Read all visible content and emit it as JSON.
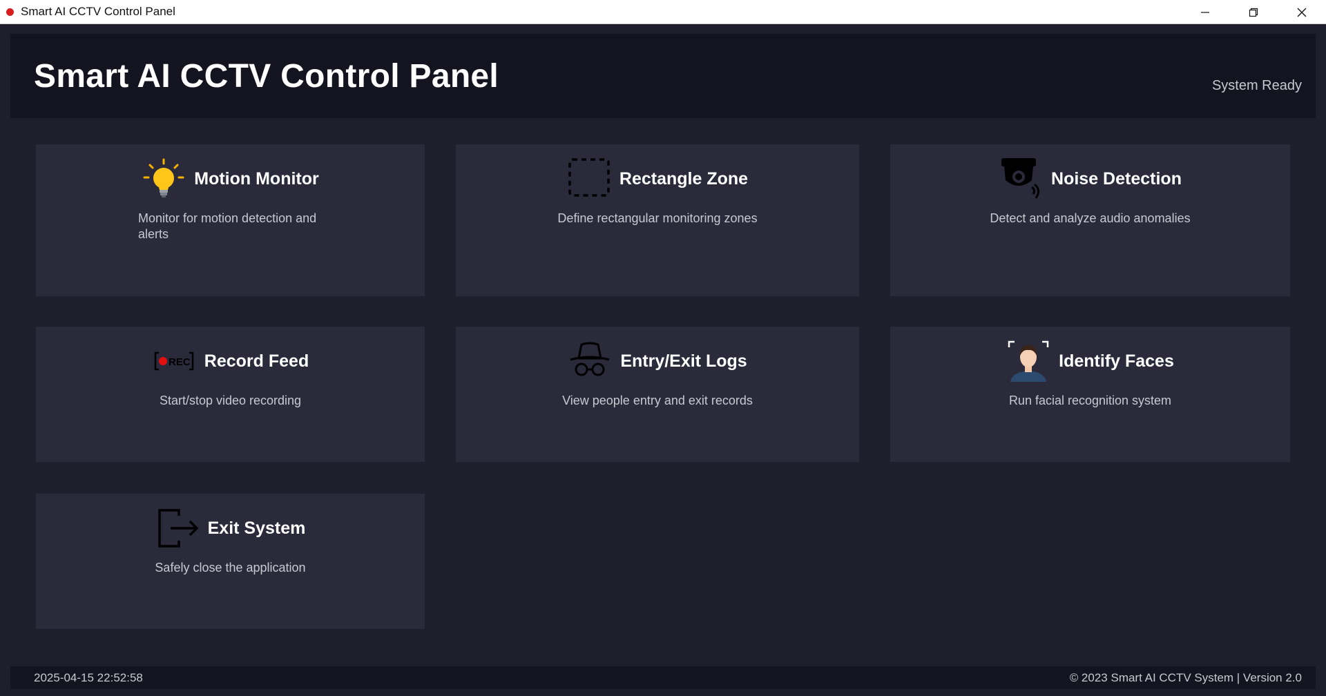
{
  "window": {
    "title": "Smart AI CCTV Control Panel",
    "accent_color": "#d81e1e",
    "controls": [
      "minimize-icon",
      "restore-icon",
      "close-icon"
    ]
  },
  "header": {
    "title": "Smart AI CCTV Control Panel",
    "status": "System Ready"
  },
  "cards": [
    {
      "icon": "lightbulb-icon",
      "title": "Motion Monitor",
      "description": "Monitor for motion detection and alerts"
    },
    {
      "icon": "dashed-rectangle-icon",
      "title": "Rectangle Zone",
      "description": "Define rectangular monitoring zones"
    },
    {
      "icon": "security-camera-icon",
      "title": "Noise Detection",
      "description": "Detect and analyze audio anomalies"
    },
    {
      "icon": "rec-icon",
      "title": "Record Feed",
      "description": "Start/stop video recording"
    },
    {
      "icon": "incognito-icon",
      "title": "Entry/Exit Logs",
      "description": "View people entry and exit records"
    },
    {
      "icon": "face-scan-icon",
      "title": "Identify Faces",
      "description": "Run facial recognition system"
    },
    {
      "icon": "exit-icon",
      "title": "Exit System",
      "description": "Safely close the application"
    }
  ],
  "footer": {
    "timestamp": "2025-04-15 22:52:58",
    "copyright": "© 2023 Smart AI CCTV System | Version 2.0"
  },
  "colors": {
    "background": "#1e1e2d",
    "header_bg": "#141420",
    "card_bg": "#2a2a3b",
    "text": "#ffffff",
    "muted_text": "#c9c9d2"
  }
}
